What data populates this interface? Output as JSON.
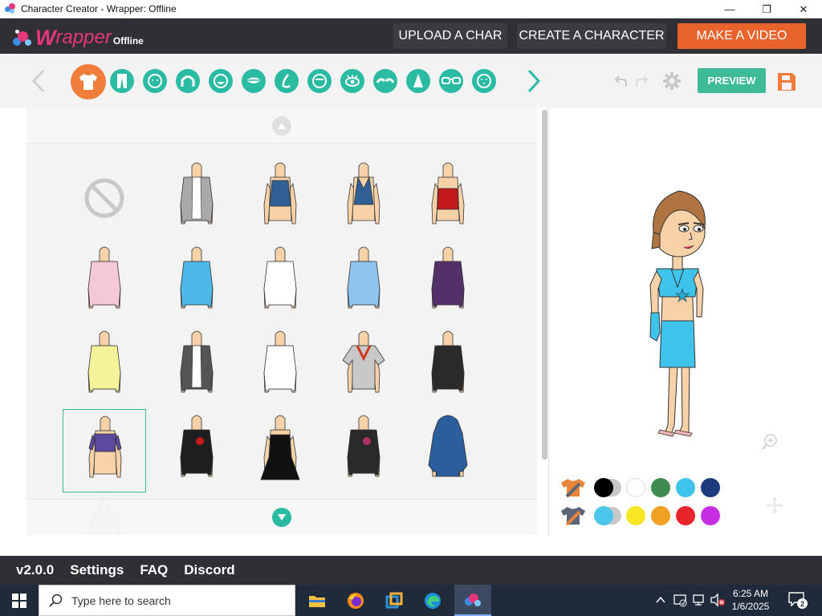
{
  "window": {
    "title": "Character Creator - Wrapper: Offline",
    "minimize_glyph": "—",
    "maximize_glyph": "❐",
    "close_glyph": "✕"
  },
  "header": {
    "logo_w": "W",
    "logo_rest": "rapper",
    "logo_suffix": "Offline",
    "buttons": {
      "upload": "UPLOAD A CHAR",
      "create": "CREATE A CHARACTER",
      "make_video": "MAKE A VIDEO"
    }
  },
  "toolbar": {
    "categories": [
      "upper-body-icon",
      "lower-body-icon",
      "face-shape-icon",
      "hair-icon",
      "beard-icon",
      "mouth-icon",
      "nose-icon",
      "forehead-icon",
      "eye-icon",
      "eyebrow-icon",
      "ear-icon",
      "glasses-icon",
      "face-mark-icon"
    ],
    "active_category": "upper-body-icon",
    "preview_label": "PREVIEW"
  },
  "grid": {
    "items": [
      {
        "type": "none"
      },
      {
        "type": "top",
        "color": "#a9a9a9",
        "inner": "#ffffff",
        "style": "jacket"
      },
      {
        "type": "top",
        "color": "#2f5f94",
        "style": "tank"
      },
      {
        "type": "top",
        "color": "#2f5f94",
        "style": "halter"
      },
      {
        "type": "top",
        "color": "#c3191d",
        "style": "tube"
      },
      {
        "type": "top",
        "color": "#f4c8d4",
        "style": "shirt"
      },
      {
        "type": "top",
        "color": "#4cb8e8",
        "style": "shirt"
      },
      {
        "type": "top",
        "color": "#ffffff",
        "style": "shirt"
      },
      {
        "type": "top",
        "color": "#8fc4ef",
        "style": "shirt"
      },
      {
        "type": "top",
        "color": "#54306a",
        "style": "jacket"
      },
      {
        "type": "top",
        "color": "#f5f39a",
        "style": "cardigan"
      },
      {
        "type": "top",
        "color": "#555555",
        "inner": "#ffffff",
        "style": "vest"
      },
      {
        "type": "top",
        "color": "#ffffff",
        "style": "shirt"
      },
      {
        "type": "top",
        "color": "#c8c8c8",
        "trim": "#d0381e",
        "style": "tee"
      },
      {
        "type": "top",
        "color": "#2a2a2a",
        "style": "corset"
      },
      {
        "type": "top",
        "color": "#5b4aa0",
        "style": "crop",
        "selected": true
      },
      {
        "type": "top",
        "color": "#1e1e1e",
        "accent": "#c41a1a",
        "style": "jacket"
      },
      {
        "type": "top",
        "color": "#111111",
        "style": "dress"
      },
      {
        "type": "top",
        "color": "#2a2a2a",
        "accent": "#b0306a",
        "style": "corset"
      },
      {
        "type": "top",
        "color": "#2c5d9c",
        "style": "hoodie"
      },
      {
        "type": "top",
        "color": "#a8e0c0",
        "style": "shirt"
      }
    ]
  },
  "palette": {
    "top_row": [
      "#000000",
      "#ffffff",
      "#3f8a4e",
      "#3ec3ea",
      "#1c3a7e"
    ],
    "bottom_row": [
      "#4dc6ec",
      "#f7e625",
      "#f0a022",
      "#e8242c",
      "#c62ee6"
    ],
    "top_active": "#000000",
    "bottom_active": "#4dc6ec"
  },
  "footer": {
    "version": "v2.0.0",
    "settings": "Settings",
    "faq": "FAQ",
    "discord": "Discord"
  },
  "taskbar": {
    "search_placeholder": "Type here to search",
    "time": "6:25 AM",
    "date": "1/6/2025",
    "notification_count": "2"
  },
  "colors": {
    "accent_teal": "#2bbba3",
    "accent_orange": "#f07d3a",
    "header_bg": "#2f2f35"
  }
}
